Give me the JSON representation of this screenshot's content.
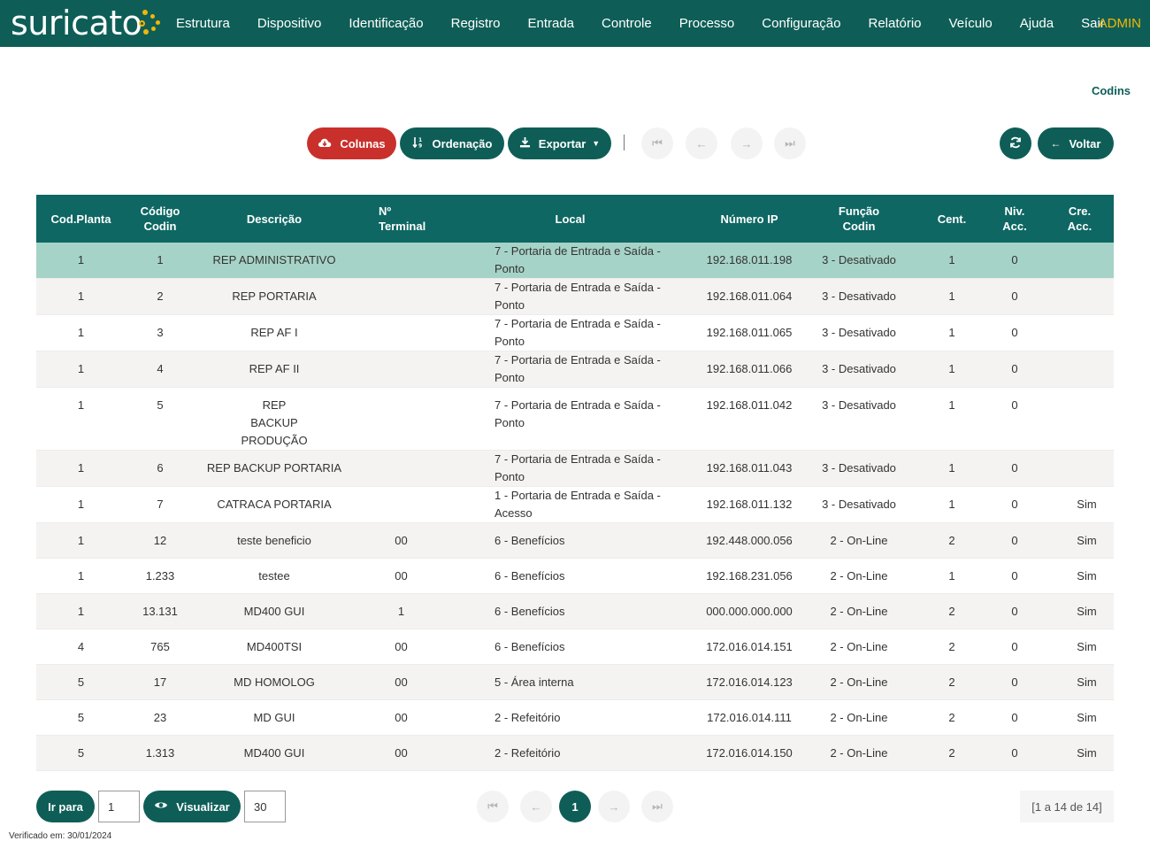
{
  "app": {
    "logo_text": "suricato",
    "user_badge": "ADMIN"
  },
  "nav": [
    "Estrutura",
    "Dispositivo",
    "Identificação",
    "Registro",
    "Entrada",
    "Controle",
    "Processo",
    "Configuração",
    "Relatório",
    "Veículo",
    "Ajuda",
    "Sair"
  ],
  "page": {
    "title": "Codins"
  },
  "toolbar": {
    "columns_label": "Colunas",
    "sort_label": "Ordenação",
    "export_label": "Exportar",
    "back_label": "Voltar"
  },
  "table": {
    "headers": [
      "Cod.Planta",
      "Código Codin",
      "Descrição",
      "Nº Terminal",
      "Local",
      "Número IP",
      "Função Codin",
      "Cent.",
      "Niv. Acc.",
      "Cre. Acc."
    ],
    "rows": [
      [
        "1",
        "1",
        "REP ADMINISTRATIVO",
        "",
        "7 - Portaria de Entrada e Saída - Ponto",
        "192.168.011.198",
        "3 - Desativado",
        "1",
        "0",
        ""
      ],
      [
        "1",
        "2",
        "REP PORTARIA",
        "",
        "7 - Portaria de Entrada e Saída - Ponto",
        "192.168.011.064",
        "3 - Desativado",
        "1",
        "0",
        ""
      ],
      [
        "1",
        "3",
        "REP AF I",
        "",
        "7 - Portaria de Entrada e Saída - Ponto",
        "192.168.011.065",
        "3 - Desativado",
        "1",
        "0",
        ""
      ],
      [
        "1",
        "4",
        "REP AF II",
        "",
        "7 - Portaria de Entrada e Saída - Ponto",
        "192.168.011.066",
        "3 - Desativado",
        "1",
        "0",
        ""
      ],
      [
        "1",
        "5",
        "REP BACKUP PRODUÇÃO",
        "",
        "7 - Portaria de Entrada e Saída - Ponto",
        "192.168.011.042",
        "3 - Desativado",
        "1",
        "0",
        ""
      ],
      [
        "1",
        "6",
        "REP BACKUP PORTARIA",
        "",
        "7 - Portaria de Entrada e Saída - Ponto",
        "192.168.011.043",
        "3 - Desativado",
        "1",
        "0",
        ""
      ],
      [
        "1",
        "7",
        "CATRACA PORTARIA",
        "",
        "1 - Portaria de Entrada e Saída - Acesso",
        "192.168.011.132",
        "3 - Desativado",
        "1",
        "0",
        "Sim"
      ],
      [
        "1",
        "12",
        "teste beneficio",
        "00",
        "6 - Benefícios",
        "192.448.000.056",
        "2 - On-Line",
        "2",
        "0",
        "Sim"
      ],
      [
        "1",
        "1.233",
        "testee",
        "00",
        "6 - Benefícios",
        "192.168.231.056",
        "2 - On-Line",
        "1",
        "0",
        "Sim"
      ],
      [
        "1",
        "13.131",
        "MD400 GUI",
        "1",
        "6 - Benefícios",
        "000.000.000.000",
        "2 - On-Line",
        "2",
        "0",
        "Sim"
      ],
      [
        "4",
        "765",
        "MD400TSI",
        "00",
        "6 - Benefícios",
        "172.016.014.151",
        "2 - On-Line",
        "2",
        "0",
        "Sim"
      ],
      [
        "5",
        "17",
        "MD HOMOLOG",
        "00",
        "5 - Área interna",
        "172.016.014.123",
        "2 - On-Line",
        "2",
        "0",
        "Sim"
      ],
      [
        "5",
        "23",
        "MD GUI",
        "00",
        "2 - Refeitório",
        "172.016.014.111",
        "2 - On-Line",
        "2",
        "0",
        "Sim"
      ],
      [
        "5",
        "1.313",
        "MD400 GUI",
        "00",
        "2 - Refeitório",
        "172.016.014.150",
        "2 - On-Line",
        "2",
        "0",
        "Sim"
      ]
    ]
  },
  "footer": {
    "goto_label": "Ir para",
    "goto_value": "1",
    "view_label": "Visualizar",
    "view_value": "30",
    "current_page": "1",
    "range_text": "[1 a 14 de 14]",
    "verified_text": "Verificado em: 30/01/2024"
  },
  "colors": {
    "primary": "#0e5e57",
    "accent": "#f2b705",
    "danger": "#c9302c",
    "selected_row": "#a6d3c7"
  }
}
